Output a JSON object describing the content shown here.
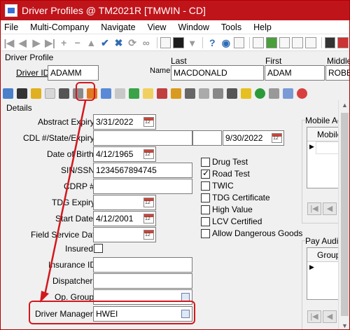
{
  "window": {
    "title": "Driver Profiles @ TM2021R [TMWIN - CD]"
  },
  "menu": [
    "File",
    "Multi-Company",
    "Navigate",
    "View",
    "Window",
    "Tools",
    "Help"
  ],
  "header": {
    "section_label": "Driver Profile",
    "driver_id_label": "Driver ID",
    "driver_id_value": "ADAMM",
    "name_label": "Name",
    "last_label": "Last",
    "first_label": "First",
    "middle_label": "Middle",
    "last_value": "MACDONALD",
    "first_value": "ADAM",
    "middle_value": "ROBER"
  },
  "details": {
    "section_label": "Details",
    "abstract_expiry_label": "Abstract Expiry",
    "abstract_expiry_value": "3/31/2022",
    "cdl_label": "CDL #/State/Expiry",
    "cdl_number": "",
    "cdl_state": "",
    "cdl_expiry": "9/30/2022",
    "dob_label": "Date of Birth",
    "dob_value": "4/12/1965",
    "sin_label": "SIN/SSN",
    "sin_value": "1234567894745",
    "cdrp_label": "CDRP #",
    "cdrp_value": "",
    "tdg_expiry_label": "TDG Expiry",
    "tdg_expiry_value": "",
    "start_date_label": "Start Date",
    "start_date_value": "4/12/2001",
    "field_service_label": "Field Service Date",
    "field_service_value": "",
    "insured_label": "Insured",
    "insurance_id_label": "Insurance ID",
    "insurance_id_value": "",
    "dispatcher_label": "Dispatcher",
    "dispatcher_value": "",
    "op_group_label": "Op. Group",
    "op_group_value": "",
    "driver_manager_label": "Driver Manager",
    "driver_manager_value": "HWEI"
  },
  "checkboxes": [
    {
      "label": "Drug Test",
      "checked": false
    },
    {
      "label": "Road Test",
      "checked": true
    },
    {
      "label": "TWIC",
      "checked": false
    },
    {
      "label": "TDG Certificate",
      "checked": false
    },
    {
      "label": "High Value",
      "checked": false
    },
    {
      "label": "LCV Certified",
      "checked": false
    },
    {
      "label": "Allow Dangerous Goods",
      "checked": false
    }
  ],
  "mobile_panel": {
    "title": "Mobile Acco",
    "column": "Mobile A"
  },
  "pay_audit_panel": {
    "title": "Pay Audit Fil",
    "column": "Grouping"
  },
  "colors": {
    "titlebar": "#c0141b",
    "highlight": "#d2181e",
    "toolbar_blue": "#2f6db5"
  }
}
